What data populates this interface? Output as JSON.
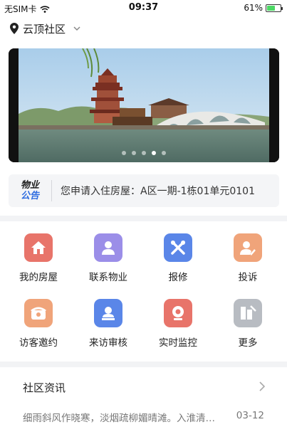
{
  "status_bar": {
    "carrier": "无SIM卡",
    "time": "09:37",
    "battery": "61%",
    "battery_level": 0.61
  },
  "location": {
    "name": "云顶社区"
  },
  "banner": {
    "slide_count": 5,
    "active_index": 3
  },
  "notice": {
    "logo_line1": "物业",
    "logo_line2": "公告",
    "text": "您申请入住房屋：A区一期-1栋01单元0101"
  },
  "menu": [
    {
      "label": "我的房屋",
      "icon": "house-icon",
      "color": "#e8746a"
    },
    {
      "label": "联系物业",
      "icon": "person-icon",
      "color": "#9b8ee8"
    },
    {
      "label": "报修",
      "icon": "tools-icon",
      "color": "#5a86e8"
    },
    {
      "label": "投诉",
      "icon": "person-edit-icon",
      "color": "#f0a47a"
    },
    {
      "label": "访客邀约",
      "icon": "phone-icon",
      "color": "#f0a47a"
    },
    {
      "label": "来访审核",
      "icon": "person-badge-icon",
      "color": "#5a86e8"
    },
    {
      "label": "实时监控",
      "icon": "camera-icon",
      "color": "#e8746a"
    },
    {
      "label": "更多",
      "icon": "more-icon",
      "color": "#b8bcc2"
    }
  ],
  "news": {
    "title": "社区资讯",
    "items": [
      {
        "text": "细雨斜风作晓寒，淡烟疏柳媚晴滩。入淮清洛渐漫漫",
        "date": "03-12"
      }
    ]
  }
}
